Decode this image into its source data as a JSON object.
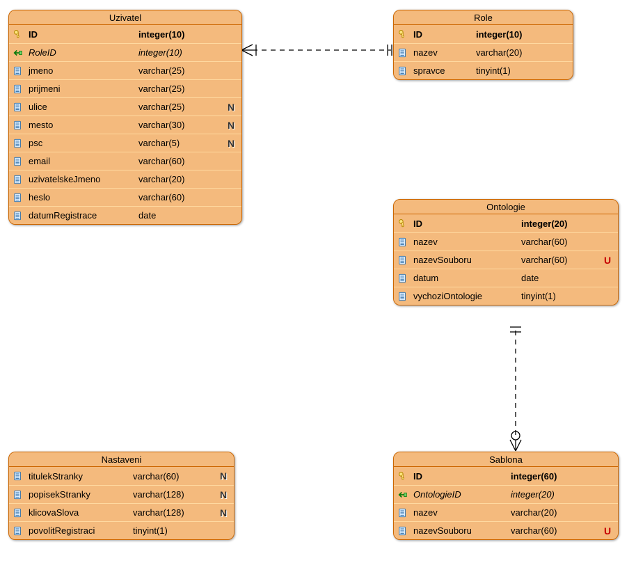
{
  "entities": {
    "uzivatel": {
      "title": "Uzivatel",
      "columns": [
        {
          "name": "ID",
          "type": "integer(10)",
          "pk": true
        },
        {
          "name": "RoleID",
          "type": "integer(10)",
          "fk": true
        },
        {
          "name": "jmeno",
          "type": "varchar(25)"
        },
        {
          "name": "prijmeni",
          "type": "varchar(25)"
        },
        {
          "name": "ulice",
          "type": "varchar(25)",
          "flag": "N"
        },
        {
          "name": "mesto",
          "type": "varchar(30)",
          "flag": "N"
        },
        {
          "name": "psc",
          "type": "varchar(5)",
          "flag": "N"
        },
        {
          "name": "email",
          "type": "varchar(60)"
        },
        {
          "name": "uzivatelskeJmeno",
          "type": "varchar(20)"
        },
        {
          "name": "heslo",
          "type": "varchar(60)"
        },
        {
          "name": "datumRegistrace",
          "type": "date"
        }
      ]
    },
    "role": {
      "title": "Role",
      "columns": [
        {
          "name": "ID",
          "type": "integer(10)",
          "pk": true
        },
        {
          "name": "nazev",
          "type": "varchar(20)"
        },
        {
          "name": "spravce",
          "type": "tinyint(1)"
        }
      ]
    },
    "ontologie": {
      "title": "Ontologie",
      "columns": [
        {
          "name": "ID",
          "type": "integer(20)",
          "pk": true
        },
        {
          "name": "nazev",
          "type": "varchar(60)"
        },
        {
          "name": "nazevSouboru",
          "type": "varchar(60)",
          "flag": "U"
        },
        {
          "name": "datum",
          "type": "date"
        },
        {
          "name": "vychoziOntologie",
          "type": "tinyint(1)"
        }
      ]
    },
    "nastaveni": {
      "title": "Nastaveni",
      "columns": [
        {
          "name": "titulekStranky",
          "type": "varchar(60)",
          "flag": "N"
        },
        {
          "name": "popisekStranky",
          "type": "varchar(128)",
          "flag": "N"
        },
        {
          "name": "klicovaSlova",
          "type": "varchar(128)",
          "flag": "N"
        },
        {
          "name": "povolitRegistraci",
          "type": "tinyint(1)"
        }
      ]
    },
    "sablona": {
      "title": "Sablona",
      "columns": [
        {
          "name": "ID",
          "type": "integer(60)",
          "pk": true
        },
        {
          "name": "OntologieID",
          "type": "integer(20)",
          "fk": true
        },
        {
          "name": "nazev",
          "type": "varchar(20)"
        },
        {
          "name": "nazevSouboru",
          "type": "varchar(60)",
          "flag": "U"
        }
      ]
    }
  },
  "relationships": [
    {
      "from": "uzivatel",
      "to": "role",
      "type": "many-to-one"
    },
    {
      "from": "sablona",
      "to": "ontologie",
      "type": "many-to-one"
    }
  ]
}
